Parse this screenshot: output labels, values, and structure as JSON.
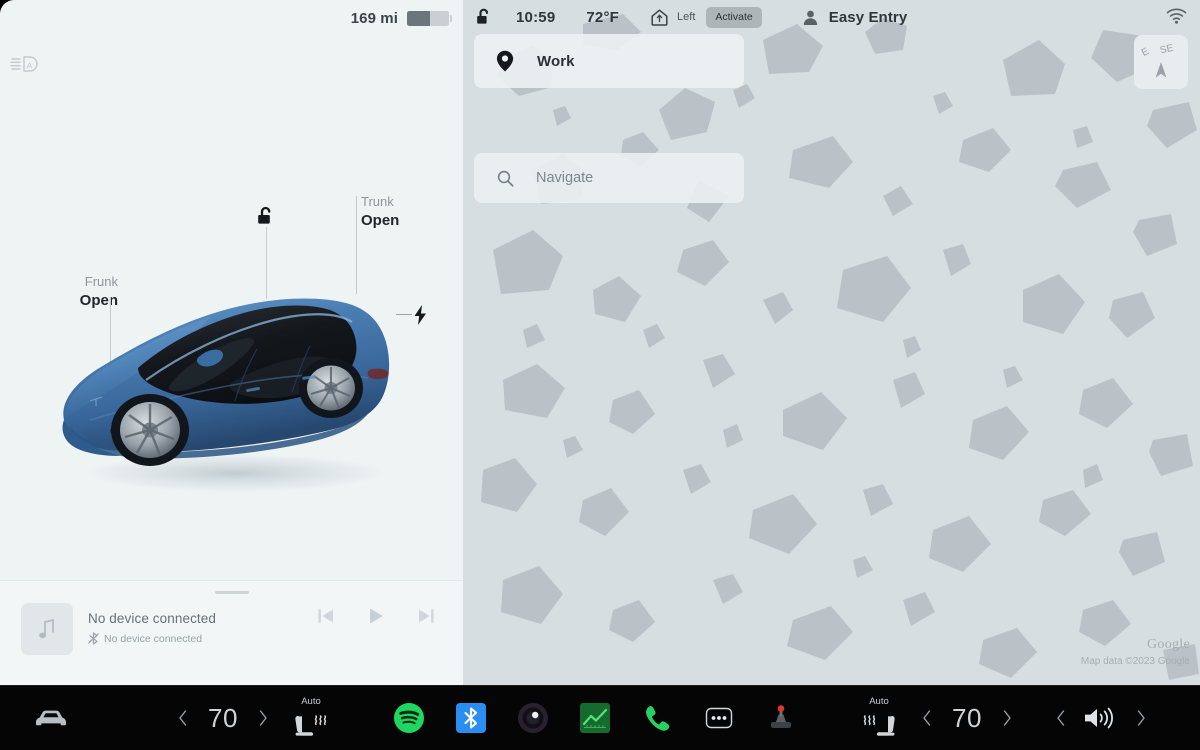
{
  "car_panel": {
    "range": "169 mi",
    "battery_percent": 55,
    "headlight_icon": "auto-headlight-icon",
    "callouts": [
      {
        "title": "Frunk",
        "state": "Open"
      },
      {
        "title": "Trunk",
        "state": "Open"
      }
    ],
    "lock_icon": "unlocked-padlock-icon",
    "charge_icon": "charge-bolt-icon",
    "car_color": "#3d6da8",
    "panel_bg": "#eef3f4"
  },
  "media": {
    "title": "No device connected",
    "subtitle": "No device connected",
    "source_icon": "bluetooth-icon",
    "album_icon": "music-note-icon",
    "controls": [
      {
        "name": "previous-track-button",
        "icon": "skip-back-icon"
      },
      {
        "name": "play-button",
        "icon": "play-icon"
      },
      {
        "name": "next-track-button",
        "icon": "skip-forward-icon"
      }
    ]
  },
  "map": {
    "topbar": {
      "lock_icon": "unlocked-padlock-icon",
      "clock": "10:59",
      "temperature": "72°F",
      "home_icon": "home-icon",
      "home_side": "Left",
      "activate_label": "Activate",
      "profile_icon": "person-icon",
      "profile_name": "Easy Entry",
      "wifi_icon": "wifi-icon"
    },
    "destination": {
      "label": "Work",
      "icon": "map-pin-icon"
    },
    "search": {
      "placeholder": "Navigate",
      "icon": "search-icon"
    },
    "compass": {
      "label_left": "E",
      "label_right": "SE",
      "arrow": "north-arrow-icon"
    },
    "attribution": {
      "logo": "Google",
      "copyright": "Map data ©2023 Google"
    },
    "colors": {
      "base": "#d6dee1",
      "blob": "#b9c1c6"
    }
  },
  "taskbar": {
    "car_icon": "car-icon",
    "left_climate": {
      "decrease_icon": "chevron-left-icon",
      "temperature": "70",
      "increase_icon": "chevron-right-icon"
    },
    "left_seat": {
      "auto_label": "Auto",
      "icon": "seat-heater-icon"
    },
    "apps": [
      {
        "name": "spotify-app-icon",
        "label": "Spotify"
      },
      {
        "name": "bluetooth-app-icon",
        "label": "Bluetooth"
      },
      {
        "name": "camera-app-icon",
        "label": "Camera"
      },
      {
        "name": "energy-app-icon",
        "label": "Energy"
      },
      {
        "name": "phone-app-icon",
        "label": "Phone"
      },
      {
        "name": "more-apps-icon",
        "label": "More"
      },
      {
        "name": "toybox-app-icon",
        "label": "Toybox"
      }
    ],
    "right_seat": {
      "auto_label": "Auto",
      "icon": "seat-heater-icon"
    },
    "right_climate": {
      "decrease_icon": "chevron-left-icon",
      "temperature": "70",
      "increase_icon": "chevron-right-icon"
    },
    "volume": {
      "decrease_icon": "chevron-left-icon",
      "icon": "volume-icon",
      "increase_icon": "chevron-right-icon"
    }
  }
}
